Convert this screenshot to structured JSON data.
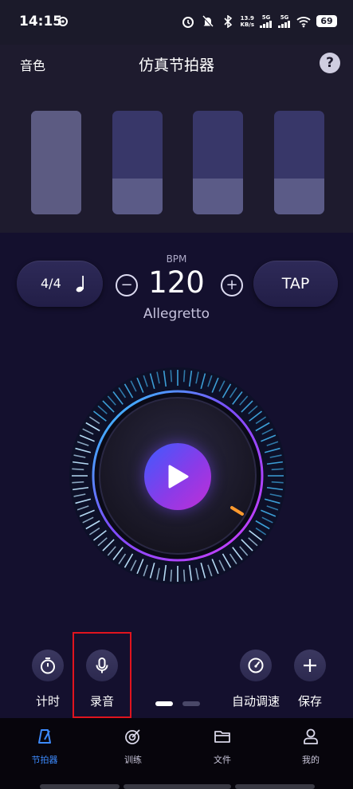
{
  "status": {
    "time": "14:15",
    "net_speed_value": "13.9",
    "net_speed_unit": "KB/s",
    "signal1": "5G",
    "signal2": "5G",
    "battery": "69"
  },
  "header": {
    "left_label": "音色",
    "title": "仿真节拍器",
    "help_label": "?"
  },
  "beats": [
    {
      "state": "accent"
    },
    {
      "state": "normal"
    },
    {
      "state": "normal"
    },
    {
      "state": "normal"
    }
  ],
  "controls": {
    "time_signature": "4/4",
    "note_icon": "quarter-note-icon",
    "bpm_label": "BPM",
    "bpm_value": "120",
    "tempo_name": "Allegretto",
    "minus_label": "−",
    "plus_label": "+",
    "tap_label": "TAP"
  },
  "tools": {
    "timer_label": "计时",
    "record_label": "录音",
    "auto_tempo_label": "自动调速",
    "save_label": "保存"
  },
  "tabs": [
    {
      "label": "节拍器",
      "icon": "metronome-icon",
      "active": true
    },
    {
      "label": "训练",
      "icon": "target-icon",
      "active": false
    },
    {
      "label": "文件",
      "icon": "folder-icon",
      "active": false
    },
    {
      "label": "我的",
      "icon": "user-icon",
      "active": false
    }
  ],
  "colors": {
    "accent_blue": "#3d8bff",
    "background": "#14102e",
    "highlight_red": "#e0141e"
  }
}
